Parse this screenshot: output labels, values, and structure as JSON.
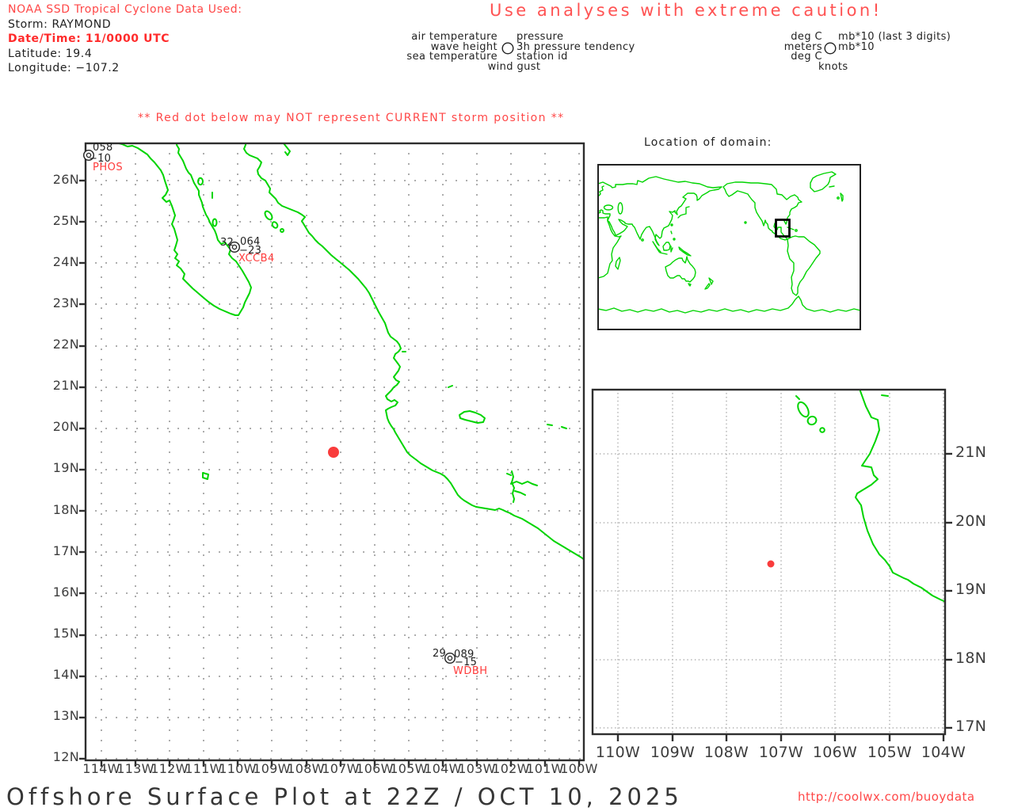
{
  "colors": {
    "coastline_green": "#00d400",
    "storm_red": "#f93c3c",
    "alert_red": "#ff4747",
    "bold_red": "#ff2b2b",
    "frame_gray": "#2e2e2e",
    "grid_gray": "#999999",
    "axis_gray": "#3d3d3d"
  },
  "header": {
    "noaa_line": "NOAA SSD Tropical Cyclone Data Used:",
    "storm_line": "Storm: RAYMOND",
    "datetime_line": "Date/Time: 11/0000 UTC",
    "latitude_line": "Latitude: 19.4",
    "longitude_line": "Longitude: −107.2",
    "caution": "Use analyses with extreme caution!"
  },
  "legend": {
    "fields": {
      "air_temp": "air temperature",
      "wave_height": "wave height",
      "sea_temp": "sea temperature",
      "wind_gust": "wind gust",
      "pressure": "pressure",
      "tendency": "3h pressure tendency",
      "station_id": "station id"
    },
    "units": {
      "air_temp": "deg C",
      "wave_height": "meters",
      "sea_temp": "deg C",
      "wind_gust": "knots",
      "pressure": "mb*10 (last 3 digits)",
      "tendency": "mb*10"
    }
  },
  "warning": "** Red dot below may NOT represent CURRENT storm position **",
  "main_map": {
    "lat_labels": [
      "26N",
      "25N",
      "24N",
      "23N",
      "22N",
      "21N",
      "20N",
      "19N",
      "18N",
      "17N",
      "16N",
      "15N",
      "14N",
      "13N",
      "12N"
    ],
    "lon_labels": [
      "114W",
      "113W",
      "112W",
      "111W",
      "110W",
      "109W",
      "108W",
      "107W",
      "106W",
      "105W",
      "104W",
      "103W",
      "102W",
      "101W",
      "100W"
    ],
    "stations": [
      {
        "id": "PHOS",
        "pressure": "058",
        "tendency": "−10"
      },
      {
        "id": "XCCB4",
        "air_temp": "32",
        "pressure": "064",
        "tendency": "−23"
      },
      {
        "id": "WDBH",
        "air_temp": "29",
        "pressure": "089",
        "tendency": "−15"
      }
    ]
  },
  "world_inset": {
    "title": "Location of domain:"
  },
  "zoom_inset": {
    "lon_labels": [
      "110W",
      "109W",
      "108W",
      "107W",
      "106W",
      "105W",
      "104W"
    ],
    "lat_labels": [
      "21N",
      "20N",
      "19N",
      "18N",
      "17N"
    ]
  },
  "footer": {
    "title": "Offshore Surface Plot at 22Z / OCT 10, 2025",
    "url": "http://coolwx.com/buoydata"
  }
}
